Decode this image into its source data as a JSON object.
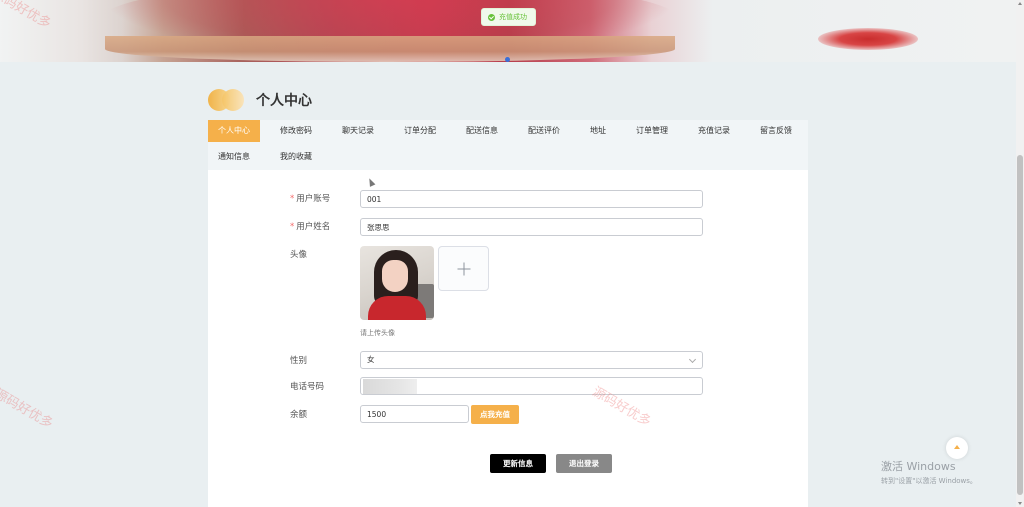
{
  "toast": {
    "text": "充值成功",
    "icon": "check-circle-icon"
  },
  "header": {
    "title": "个人中心",
    "logo_icon": "double-circle-logo-icon"
  },
  "tabs": [
    {
      "label": "个人中心",
      "active": true
    },
    {
      "label": "修改密码"
    },
    {
      "label": "聊天记录"
    },
    {
      "label": "订单分配"
    },
    {
      "label": "配送信息"
    },
    {
      "label": "配送评价"
    },
    {
      "label": "地址"
    },
    {
      "label": "订单管理"
    },
    {
      "label": "充值记录"
    },
    {
      "label": "留言反馈"
    },
    {
      "label": "通知信息"
    },
    {
      "label": "我的收藏"
    }
  ],
  "form": {
    "account": {
      "label": "用户账号",
      "value": "001",
      "required": true
    },
    "name": {
      "label": "用户姓名",
      "value": "张思思",
      "required": true
    },
    "avatar": {
      "label": "头像",
      "hint": "请上传头像",
      "upload_icon": "plus-icon"
    },
    "gender": {
      "label": "性别",
      "value": "女"
    },
    "phone": {
      "label": "电话号码",
      "value": ""
    },
    "balance": {
      "label": "余额",
      "value": "1500",
      "recharge_button": "点我充值"
    }
  },
  "actions": {
    "update": "更新信息",
    "logout": "退出登录"
  },
  "watermark": {
    "text": "源码好优多"
  },
  "windows_activation": {
    "line1": "激活 Windows",
    "line2": "转到\"设置\"以激活 Windows。"
  },
  "colors": {
    "accent": "#f5b04a",
    "success": "#67c23a",
    "required": "#f56c6c"
  }
}
